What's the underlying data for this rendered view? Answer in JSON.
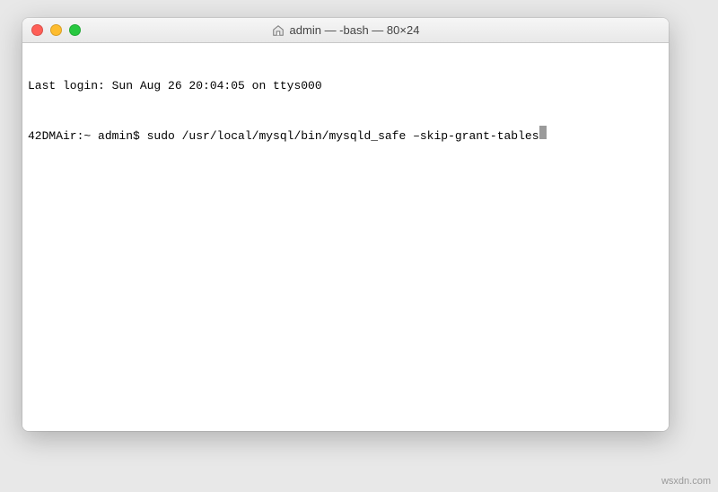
{
  "window": {
    "title": "admin — -bash — 80×24",
    "icon": "home-icon"
  },
  "trafficLights": {
    "close": "close",
    "minimize": "minimize",
    "maximize": "maximize"
  },
  "terminal": {
    "lastLogin": "Last login: Sun Aug 26 20:04:05 on ttys000",
    "promptHost": "42DMAir:~ admin$ ",
    "command": "sudo /usr/local/mysql/bin/mysqld_safe –skip-grant-tables"
  },
  "watermark": "wsxdn.com"
}
